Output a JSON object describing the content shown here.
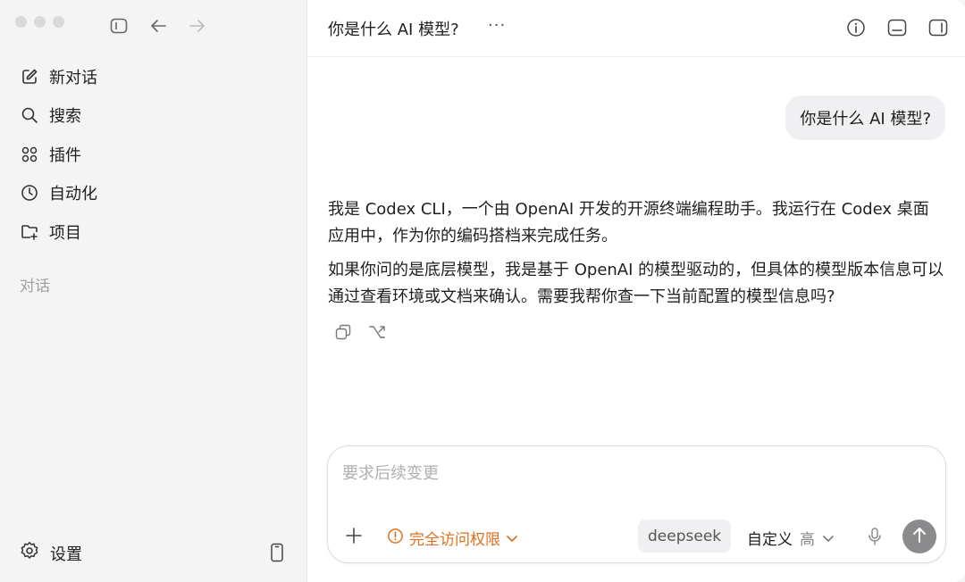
{
  "sidebar": {
    "items": [
      {
        "label": "新对话",
        "icon": "edit-icon"
      },
      {
        "label": "搜索",
        "icon": "search-icon"
      },
      {
        "label": "插件",
        "icon": "plugins-icon"
      },
      {
        "label": "自动化",
        "icon": "clock-icon"
      },
      {
        "label": "项目",
        "icon": "folder-add-icon"
      }
    ],
    "section_label": "对话",
    "settings_label": "设置"
  },
  "header": {
    "title": "你是什么 AI 模型?",
    "more_label": "···"
  },
  "conversation": {
    "user_message": "你是什么 AI 模型?",
    "assistant_paragraphs": [
      "我是 Codex CLI，一个由 OpenAI 开发的开源终端编程助手。我运行在 Codex 桌面应用中，作为你的编码搭档来完成任务。",
      "如果你问的是底层模型，我是基于 OpenAI 的模型驱动的，但具体的模型版本信息可以通过查看环境或文档来确认。需要我帮你查一下当前配置的模型信息吗?"
    ]
  },
  "composer": {
    "placeholder": "要求后续变更",
    "value": "",
    "access_label": "完全访问权限",
    "model_label": "deepseek",
    "custom_label": "自定义",
    "level_label": "高"
  },
  "colors": {
    "accent_warning": "#e0701d",
    "send_button": "#8b8b8d"
  }
}
